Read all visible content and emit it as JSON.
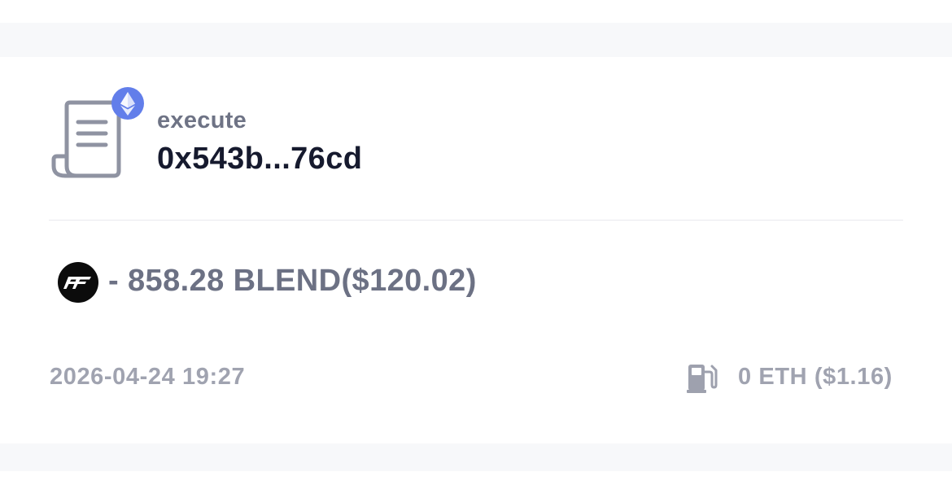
{
  "transaction": {
    "method": "execute",
    "address": "0x543b...76cd",
    "network_badge_icon": "ethereum-icon",
    "contract_icon": "scroll-document-icon"
  },
  "token_change": {
    "logo_icon": "blend-token-logo-icon",
    "amount_text": "- 858.28 BLEND($120.02)"
  },
  "footer": {
    "timestamp": "2026-04-24 19:27",
    "gas_icon": "gas-pump-icon",
    "fee_text": "0 ETH ($1.16)"
  },
  "colors": {
    "ethereum_badge": "#627eea",
    "title_text": "#161a2e",
    "muted_text": "#6c7184",
    "light_text": "#a0a3b0",
    "band_background": "#f7f8fa"
  }
}
